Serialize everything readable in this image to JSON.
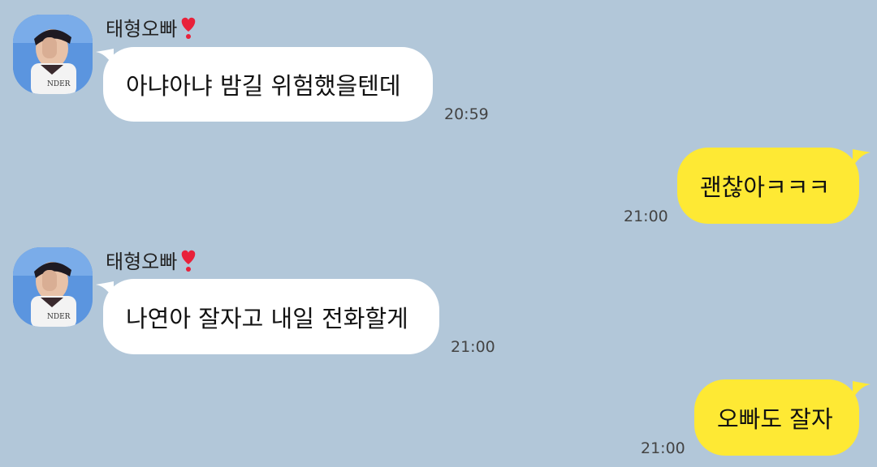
{
  "chat": {
    "messages": [
      {
        "sender": "태형오빠",
        "text": "아냐아냐 밤길 위험했을텐데",
        "time": "20:59",
        "direction": "incoming"
      },
      {
        "text": "괜찮아ㅋㅋㅋ",
        "time": "21:00",
        "direction": "outgoing"
      },
      {
        "sender": "태형오빠",
        "text": "나연아 잘자고 내일 전화할게",
        "time": "21:00",
        "direction": "incoming"
      },
      {
        "text": "오빠도 잘자",
        "time": "21:00",
        "direction": "outgoing"
      }
    ]
  },
  "colors": {
    "background": "#b2c7d9",
    "incoming_bubble": "#ffffff",
    "outgoing_bubble": "#fee934",
    "heart": "#e8213a"
  },
  "icons": {
    "sender_badge": "heart-exclamation-icon"
  }
}
